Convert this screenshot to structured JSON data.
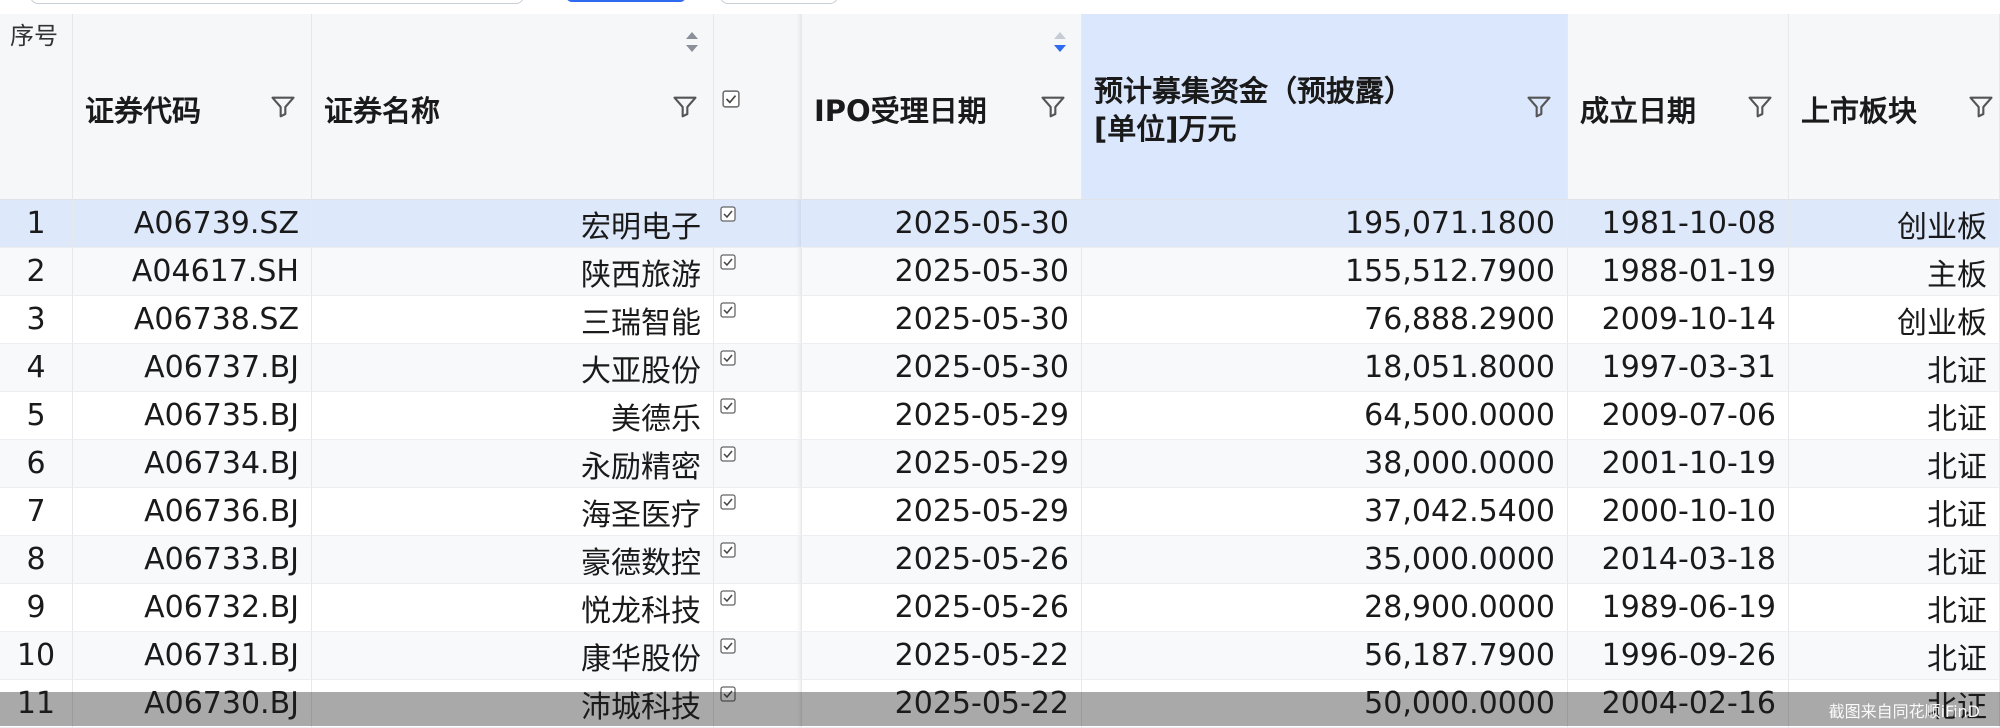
{
  "header": {
    "seq": "序号",
    "code": "证券代码",
    "name": "证券名称",
    "ipo_date": "IPO受理日期",
    "funds_line1": "预计募集资金（预披露）",
    "funds_line2": "[单位]万元",
    "found_date": "成立日期",
    "board": "上市板块"
  },
  "icons": {
    "filter": "filter-icon",
    "sort": "sort-icon",
    "checkbox": "checkbox-icon"
  },
  "colors": {
    "active_header": "#dbe7fc",
    "selected_row": "#dde8fb",
    "sort_active": "#2f6bf0"
  },
  "rows": [
    {
      "seq": "1",
      "code": "A06739.SZ",
      "name": "宏明电子",
      "ipo": "2025-05-30",
      "funds": "195,071.1800",
      "found": "1981-10-08",
      "board": "创业板"
    },
    {
      "seq": "2",
      "code": "A04617.SH",
      "name": "陕西旅游",
      "ipo": "2025-05-30",
      "funds": "155,512.7900",
      "found": "1988-01-19",
      "board": "主板"
    },
    {
      "seq": "3",
      "code": "A06738.SZ",
      "name": "三瑞智能",
      "ipo": "2025-05-30",
      "funds": "76,888.2900",
      "found": "2009-10-14",
      "board": "创业板"
    },
    {
      "seq": "4",
      "code": "A06737.BJ",
      "name": "大亚股份",
      "ipo": "2025-05-30",
      "funds": "18,051.8000",
      "found": "1997-03-31",
      "board": "北证"
    },
    {
      "seq": "5",
      "code": "A06735.BJ",
      "name": "美德乐",
      "ipo": "2025-05-29",
      "funds": "64,500.0000",
      "found": "2009-07-06",
      "board": "北证"
    },
    {
      "seq": "6",
      "code": "A06734.BJ",
      "name": "永励精密",
      "ipo": "2025-05-29",
      "funds": "38,000.0000",
      "found": "2001-10-19",
      "board": "北证"
    },
    {
      "seq": "7",
      "code": "A06736.BJ",
      "name": "海圣医疗",
      "ipo": "2025-05-29",
      "funds": "37,042.5400",
      "found": "2000-10-10",
      "board": "北证"
    },
    {
      "seq": "8",
      "code": "A06733.BJ",
      "name": "豪德数控",
      "ipo": "2025-05-26",
      "funds": "35,000.0000",
      "found": "2014-03-18",
      "board": "北证"
    },
    {
      "seq": "9",
      "code": "A06732.BJ",
      "name": "悦龙科技",
      "ipo": "2025-05-26",
      "funds": "28,900.0000",
      "found": "1989-06-19",
      "board": "北证"
    },
    {
      "seq": "10",
      "code": "A06731.BJ",
      "name": "康华股份",
      "ipo": "2025-05-22",
      "funds": "56,187.7900",
      "found": "1996-09-26",
      "board": "北证"
    },
    {
      "seq": "11",
      "code": "A06730.BJ",
      "name": "沛城科技",
      "ipo": "2025-05-22",
      "funds": "50,000.0000",
      "found": "2004-02-16",
      "board": "北证"
    }
  ],
  "watermark": "截图来自同花顺iFinD"
}
